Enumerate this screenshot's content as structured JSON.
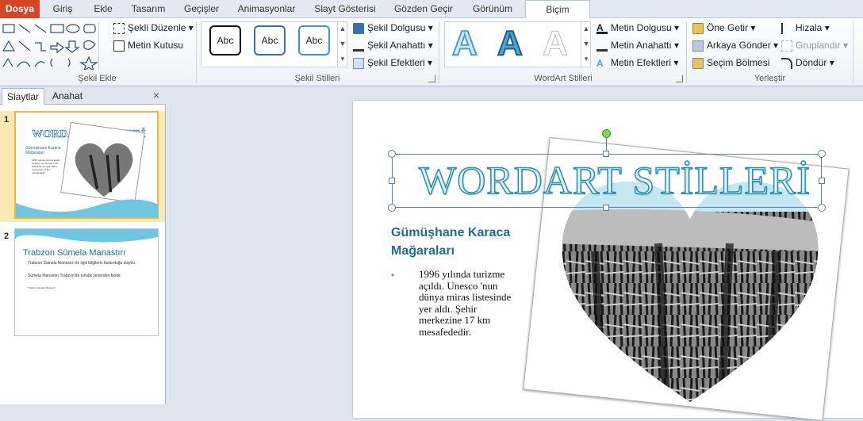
{
  "tabs": [
    "Dosya",
    "Giriş",
    "Ekle",
    "Tasarım",
    "Geçişler",
    "Animasyonlar",
    "Slayt Gösterisi",
    "Gözden Geçir",
    "Görünüm",
    "Biçim"
  ],
  "ribbon": {
    "shapes": {
      "edit_shape": "Şekli Düzenle",
      "text_box": "Metin Kutusu",
      "label": "Şekil Ekle"
    },
    "shape_styles": {
      "samples": [
        "Abc",
        "Abc",
        "Abc"
      ],
      "fill": "Şekil Dolgusu",
      "outline": "Şekil Anahattı",
      "effects": "Şekil Efektleri",
      "label": "Şekil Stilleri"
    },
    "wordart": {
      "sample": "A",
      "text_fill": "Metin Dolgusu",
      "text_outline": "Metin Anahattı",
      "text_effects": "Metin Efektleri",
      "label": "WordArt Stilleri"
    },
    "arrange": {
      "bring_forward": "Öne Getir",
      "send_backward": "Arkaya Gönder",
      "selection_pane": "Seçim Bölmesi",
      "align": "Hizala",
      "group": "Gruplandır",
      "rotate": "Döndür",
      "label": "Yerleştir"
    }
  },
  "panel": {
    "tab_slides": "Slaytlar",
    "tab_outline": "Anahat",
    "close": "×",
    "thumbs": [
      {
        "num": "1",
        "title": "WORDART STİLLERİ",
        "subtitle": "Gümüşhane Karaca Mağaraları",
        "body": "1996 yılında turizme açıldı. Unesco 'nun dünya miras listesinde yer aldı. Şehir merkezine 17 km mesafededir."
      },
      {
        "num": "2",
        "title": "Trabzon Sümela Manastırı",
        "body1": "Trabzon Sümela Manastırı ile ilgili bilgilerin bulunduğu slayttır.",
        "body2": "Sümela Manastırı Trabzon'da turistik yerlerden biridir.",
        "body3": "Trabzon Sümela Manastırı"
      }
    ]
  },
  "slide": {
    "title": "WORDART STİLLERİ",
    "subtitle_line1": "Gümüşhane Karaca",
    "subtitle_line2": "Mağaraları",
    "bullet": "•",
    "body_lines": [
      "1996 yılında turizme",
      "açıldı.  Unesco 'nun",
      "dünya miras listesinde",
      "yer aldı. Şehir",
      "merkezine 17 km",
      "mesafededir."
    ]
  },
  "colors": {
    "file_tab": "#d24726",
    "title_teal": "#6fc2d6",
    "subtitle_blue": "#1f6d8c",
    "selection": "#5a7fa8"
  }
}
